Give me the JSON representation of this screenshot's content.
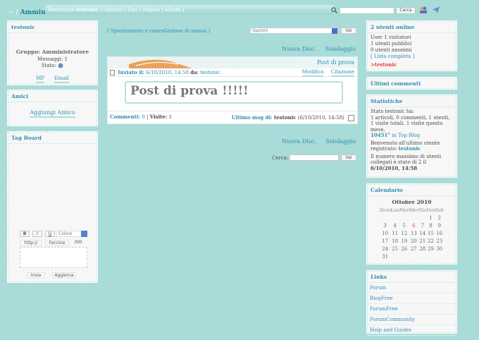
{
  "topbar": {
    "brand_prefix": "~ ( ",
    "brand": "Amministr",
    "welcome_prefix": "Benvenuto ",
    "welcome_user": "testonic",
    "welcome_links": " ( Opzioni | Esci ) Pagina | Album ]",
    "search_button": "Cerca"
  },
  "profile": {
    "title": "testonic",
    "group": "Gruppo: Amministratore",
    "messages": "Messaggi: 1",
    "state": "Stato:",
    "mp": "MP",
    "email": "Email"
  },
  "friends": {
    "title": "Amici",
    "add": "Aggiungi Amico"
  },
  "tagboard": {
    "title": "Tag Board",
    "bold": "B",
    "italic": "I",
    "underline": "U",
    "color": "Colore",
    "url": "http://",
    "smilies": "Faccine",
    "counter": "300",
    "send": "Invia",
    "refresh": "Aggiorna"
  },
  "main": {
    "move_link": "( Spostamento e cancellazione di massa )",
    "options_select": "Opzioni",
    "go": "Vai",
    "new_topic": "Nuova Disc.",
    "poll": "Sondaggio",
    "new_topic2": "Nuova Disc.",
    "poll2": "Sondaggio",
    "search_label": "Cerca:",
    "go2": "Vai"
  },
  "post": {
    "title": "Post di prova",
    "sent_label": "Inviato il:",
    "sent_date": "6/10/2010, 14:58",
    "by_label": "da:",
    "author": "testonic",
    "edit": "Modifica",
    "quote": "Citazione",
    "content": "Post di prova !!!!!",
    "comments_label": "Commenti:",
    "comments": "0",
    "views_label": "Visite:",
    "views": "1",
    "last_label": "Ultimo msg di:",
    "last_author": "testonic",
    "last_date": "(6/10/2010, 14:58)"
  },
  "online": {
    "title": "2 utenti online",
    "line1": "User 1 visitatori",
    "line2": "1 utenti pubblici",
    "line3": "0 utenti anonimi",
    "list": "[ Lista completa ]",
    "user": ">testonic"
  },
  "comments": {
    "title": "Ultimi commenti"
  },
  "stats": {
    "title": "Statistiche",
    "l1": "Stats testonic ha:",
    "l2": "1 articoli, 0 commenti, 1 utenti,",
    "l3": "1 visite totali, 1 visite questo",
    "l4": "mese,",
    "rank": "10451°",
    "rank_suffix": " in Top Blog",
    "l5": "Benvenuto all'ultimo utente",
    "l6": "registrato:",
    "l6_user": "testonic",
    "l7": "Il numero massimo di utenti",
    "l8": "collegati è stato di 2 il",
    "l9": "6/10/2010, 14:58"
  },
  "calendar": {
    "title": "Calendario",
    "month": "Ottobre 2010",
    "dow": [
      "Dom",
      "Lun",
      "Mar",
      "Mer",
      "Gio",
      "Ven",
      "Sab"
    ],
    "weeks": [
      [
        "",
        "",
        "",
        "",
        "",
        "1",
        "2"
      ],
      [
        "3",
        "4",
        "5",
        "6",
        "7",
        "8",
        "9"
      ],
      [
        "10",
        "11",
        "12",
        "13",
        "14",
        "15",
        "16"
      ],
      [
        "17",
        "18",
        "19",
        "20",
        "21",
        "22",
        "23"
      ],
      [
        "24",
        "25",
        "26",
        "27",
        "28",
        "29",
        "30"
      ],
      [
        "31",
        "",
        "",
        "",
        "",
        "",
        ""
      ]
    ],
    "today": "6"
  },
  "links": {
    "title": "Links",
    "items": [
      "Forum",
      "BlogFree",
      "ForumFree",
      "ForumCommunity",
      "Help and Guides"
    ]
  }
}
